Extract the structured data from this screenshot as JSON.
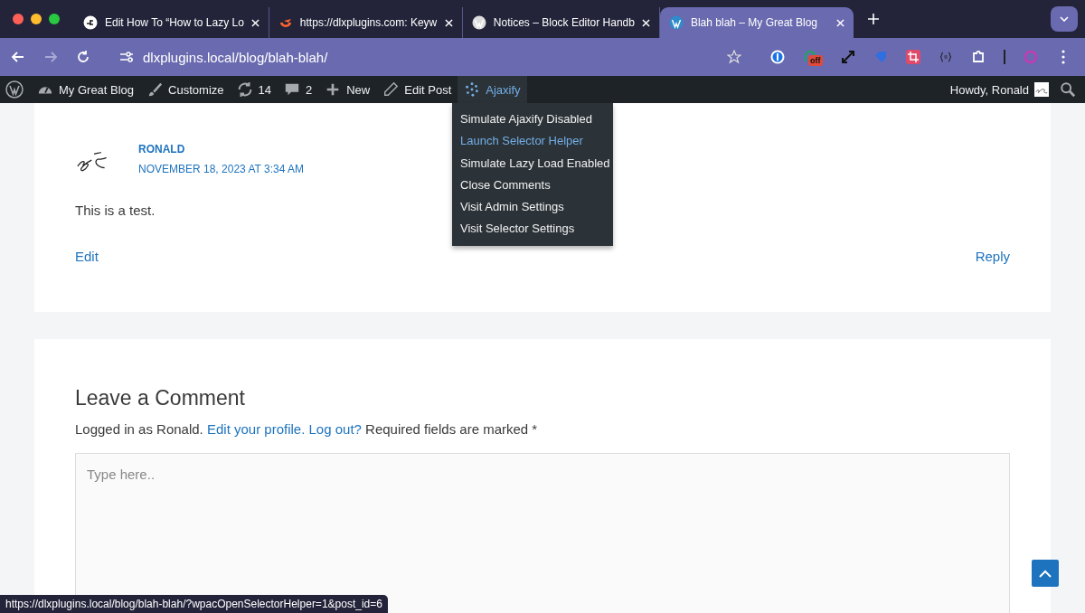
{
  "tabs": [
    {
      "title": "Edit How To “How to Lazy Lo",
      "selected": false
    },
    {
      "title": "https://dlxplugins.com: Keyw",
      "selected": false
    },
    {
      "title": "Notices – Block Editor Handb",
      "selected": false
    },
    {
      "title": "Blah blah – My Great Blog",
      "selected": true
    }
  ],
  "address": "dlxplugins.local/blog/blah-blah/",
  "extension_badge": "off",
  "admin_bar": {
    "items": [
      {
        "kind": "dashboard",
        "label": "My Great Blog",
        "selected": false
      },
      {
        "kind": "brush",
        "label": "Customize",
        "selected": false
      },
      {
        "kind": "updates",
        "label": "14",
        "selected": false
      },
      {
        "kind": "comments",
        "label": "2",
        "selected": false
      },
      {
        "kind": "plus",
        "label": "New",
        "selected": false
      },
      {
        "kind": "pencil",
        "label": "Edit Post",
        "selected": false
      },
      {
        "kind": "dots",
        "label": "Ajaxify",
        "selected": true
      }
    ],
    "menu": [
      {
        "label": "Simulate Ajaxify Disabled",
        "selected": false
      },
      {
        "label": "Launch Selector Helper",
        "selected": true
      },
      {
        "label": "Simulate Lazy Load Enabled",
        "selected": false
      },
      {
        "label": "Close Comments",
        "selected": false
      },
      {
        "label": "Visit Admin Settings",
        "selected": false
      },
      {
        "label": "Visit Selector Settings",
        "selected": false
      }
    ],
    "greeting": "Howdy, Ronald"
  },
  "comment": {
    "author": "RONALD",
    "date": "NOVEMBER 18, 2023 AT 3:34 AM",
    "text": "This is a test.",
    "edit": "Edit",
    "reply": "Reply"
  },
  "form": {
    "heading": "Leave a Comment",
    "intro": "Logged in as Ronald.",
    "profile_link": "Edit your profile.",
    "logout_link": "Log out?",
    "required": "Required fields are marked *",
    "placeholder": "Type here.."
  },
  "status_url": "https://dlxplugins.local/blog/blah-blah/?wpacOpenSelectorHelper=1&post_id=6"
}
